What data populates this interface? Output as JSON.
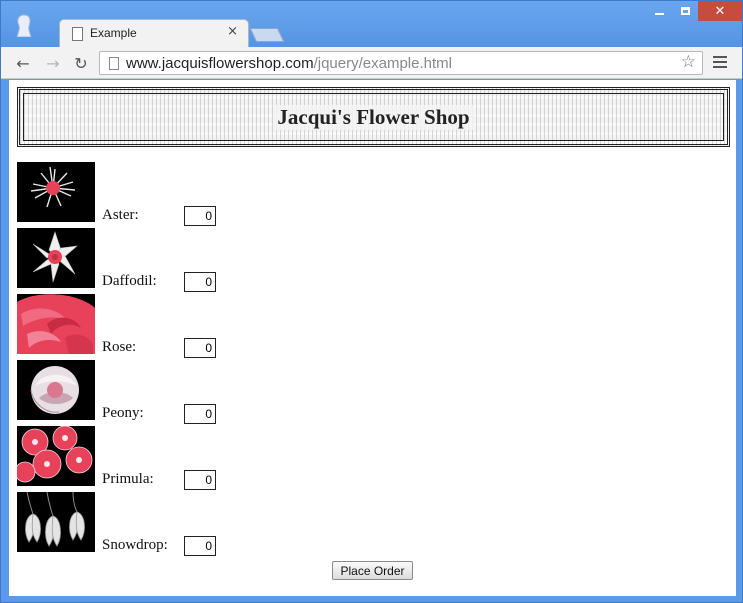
{
  "browser": {
    "tab_title": "Example",
    "tab_close": "×",
    "url_host": "www.jacquisflowershop.com",
    "url_path": "/jquery/example.html",
    "back_glyph": "←",
    "forward_glyph": "→",
    "reload_glyph": "↻",
    "star_glyph": "☆",
    "close_glyph": "✕"
  },
  "page": {
    "title": "Jacqui's Flower Shop",
    "flowers": [
      {
        "name": "Aster:",
        "quantity": "0",
        "icon": "aster-image"
      },
      {
        "name": "Daffodil:",
        "quantity": "0",
        "icon": "daffodil-image"
      },
      {
        "name": "Rose:",
        "quantity": "0",
        "icon": "rose-image"
      },
      {
        "name": "Peony:",
        "quantity": "0",
        "icon": "peony-image"
      },
      {
        "name": "Primula:",
        "quantity": "0",
        "icon": "primula-image"
      },
      {
        "name": "Snowdrop:",
        "quantity": "0",
        "icon": "snowdrop-image"
      }
    ],
    "order_button": "Place Order"
  },
  "colors": {
    "window_frame": "#5b9ae8",
    "close_button": "#c74b3f",
    "flower_pink": "#e8415a"
  }
}
